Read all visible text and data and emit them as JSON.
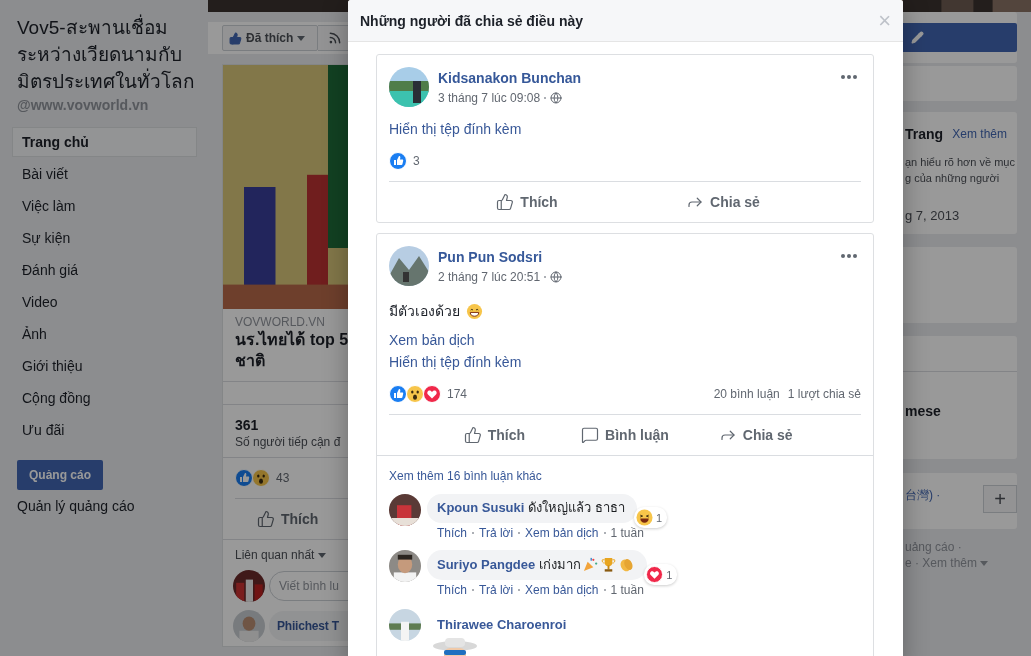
{
  "sidebar": {
    "title": "Vov5-สะพานเชื่อมระหว่างเวียดนามกับมิตรประเทศในทั่วโลก",
    "handle": "@www.vovworld.vn",
    "nav": [
      {
        "label": "Trang chủ",
        "selected": true
      },
      {
        "label": "Bài viết",
        "selected": false
      },
      {
        "label": "Việc làm",
        "selected": false
      },
      {
        "label": "Sự kiện",
        "selected": false
      },
      {
        "label": "Đánh giá",
        "selected": false
      },
      {
        "label": "Video",
        "selected": false
      },
      {
        "label": "Ảnh",
        "selected": false
      },
      {
        "label": "Giới thiệu",
        "selected": false
      },
      {
        "label": "Cộng đồng",
        "selected": false
      },
      {
        "label": "Ưu đãi",
        "selected": false
      }
    ],
    "ad_button": "Quảng cáo",
    "ad_manager": "Quản lý quảng cáo"
  },
  "feed": {
    "like_button": "Đã thích",
    "source": "VOVWORLD.VN",
    "title_lines": [
      "นร.ไทยได้ top 5",
      "ชาติ"
    ],
    "reach_count": "361",
    "reach_label": "Số người tiếp cận đ",
    "reaction_count": "43",
    "like_action": "Thích",
    "sort": "Liên quan nhất",
    "comment_placeholder": "Viết bình lu",
    "commenter": "Phiichest T"
  },
  "right_panel": {
    "about_title": "Trang",
    "see_more": "Xem thêm",
    "about_lines": [
      "ạn hiểu rõ hơn về mục",
      "g của những người"
    ],
    "date": "g 7, 2013",
    "language_title": "mese",
    "language": "台灣) ·",
    "add": "+",
    "footer_lines": [
      "uảng cáo ·",
      "e · Xem thêm"
    ]
  },
  "dialog": {
    "title": "Những người đã chia sẻ điều này",
    "close": "×",
    "shares": [
      {
        "author": "Kidsanakon Bunchan",
        "time": "3 tháng 7 lúc 09:08",
        "lines": [
          {
            "kind": "link",
            "text": "Hiển thị tệp đính kèm"
          }
        ],
        "reaction_count": "3",
        "actions": [
          {
            "kind": "like",
            "label": "Thích"
          },
          {
            "kind": "share",
            "label": "Chia sẻ"
          }
        ]
      },
      {
        "author": "Pun Pun Sodsri",
        "time": "2 tháng 7 lúc 20:51",
        "lines": [
          {
            "kind": "text",
            "text": "มีตัวเองด้วย"
          },
          {
            "kind": "link",
            "text": "Xem bản dịch"
          },
          {
            "kind": "link",
            "text": "Hiển thị tệp đính kèm"
          }
        ],
        "reaction_count": "174",
        "comments_count": "20 bình luận",
        "shares_count": "1 lượt chia sẻ",
        "actions": [
          {
            "kind": "like",
            "label": "Thích"
          },
          {
            "kind": "comment",
            "label": "Bình luận"
          },
          {
            "kind": "share",
            "label": "Chia sẻ"
          }
        ],
        "comments": {
          "more": "Xem thêm 16 bình luận khác",
          "items": [
            {
              "kind": "text",
              "author": "Kpoun Susuki",
              "text": "ดังใหญ่แล้ว ธาธา",
              "reaction": {
                "kind": "laugh",
                "count": "1"
              },
              "actions": [
                "Thích",
                "Trả lời",
                "Xem bản dịch"
              ],
              "time": "1 tuần"
            },
            {
              "kind": "text",
              "author": "Suriyo Pangdee",
              "text": "เก่งมาก",
              "reaction": {
                "kind": "love",
                "count": "1"
              },
              "actions": [
                "Thích",
                "Trả lời",
                "Xem bản dịch"
              ],
              "time": "1 tuần"
            },
            {
              "kind": "sticker",
              "author": "Thirawee Charoenroi"
            }
          ]
        }
      }
    ]
  }
}
